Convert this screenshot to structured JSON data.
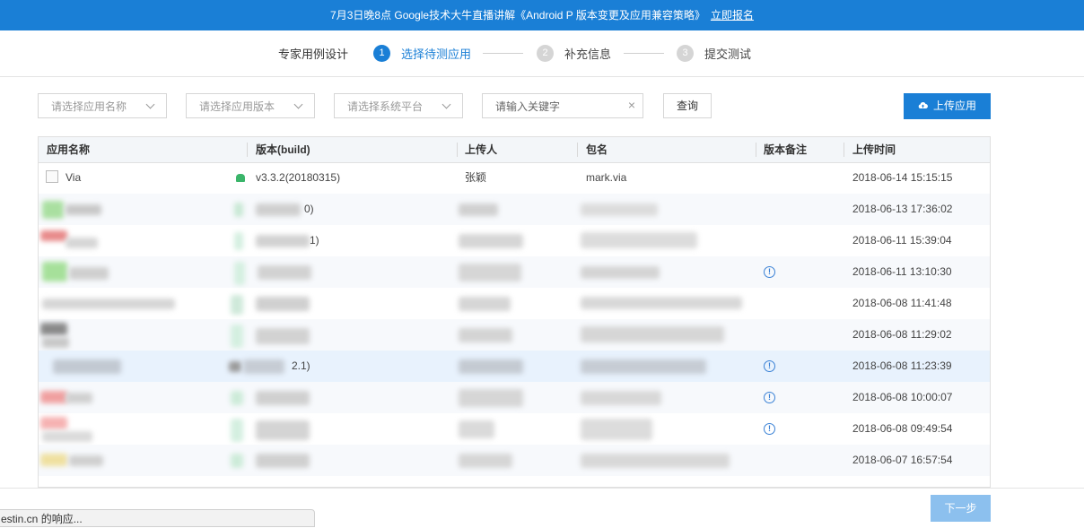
{
  "banner": {
    "text": "7月3日晚8点 Google技术大牛直播讲解《Android P 版本变更及应用兼容策略》",
    "link": "立即报名"
  },
  "steps": {
    "first": "专家用例设计",
    "items": [
      {
        "num": "1",
        "label": "选择待测应用"
      },
      {
        "num": "2",
        "label": "补充信息"
      },
      {
        "num": "3",
        "label": "提交测试"
      }
    ]
  },
  "filters": {
    "app_name": "请选择应用名称",
    "app_version": "请选择应用版本",
    "platform": "请选择系统平台",
    "keyword_placeholder": "请输入关键字",
    "clear_glyph": "×",
    "query": "查询",
    "upload": "上传应用"
  },
  "table": {
    "columns": [
      "应用名称",
      "版本(build)",
      "上传人",
      "包名",
      "版本备注",
      "上传时间"
    ],
    "rows": [
      {
        "name": "Via",
        "version": "v3.3.2(20180315)",
        "uploader": "张颖",
        "package": "mark.via",
        "note": false,
        "time": "2018-06-14 15:15:15"
      },
      {
        "name": "",
        "version": "0)",
        "uploader": "",
        "package": "",
        "note": false,
        "time": "2018-06-13 17:36:02"
      },
      {
        "name": "",
        "version": "1)",
        "uploader": "",
        "package": "",
        "note": false,
        "time": "2018-06-11 15:39:04"
      },
      {
        "name": "",
        "version": "",
        "uploader": "",
        "package": "",
        "note": true,
        "time": "2018-06-11 13:10:30"
      },
      {
        "name": "",
        "version": "",
        "uploader": "",
        "package": "",
        "note": false,
        "time": "2018-06-08 11:41:48"
      },
      {
        "name": "",
        "version": "",
        "uploader": "",
        "package": "",
        "note": false,
        "time": "2018-06-08 11:29:02"
      },
      {
        "name": "",
        "version": "2.1)",
        "uploader": "",
        "package": "",
        "note": true,
        "time": "2018-06-08 11:23:39"
      },
      {
        "name": "",
        "version": "",
        "uploader": "",
        "package": "",
        "note": true,
        "time": "2018-06-08 10:00:07"
      },
      {
        "name": "",
        "version": "",
        "uploader": "",
        "package": "",
        "note": true,
        "time": "2018-06-08 09:49:54"
      },
      {
        "name": "",
        "version": "",
        "uploader": "",
        "package": "",
        "note": false,
        "time": "2018-06-07 16:57:54"
      }
    ]
  },
  "footer": {
    "next": "下一步",
    "status": "estin.cn 的响应..."
  },
  "colors": {
    "brand": "#1a7fd6",
    "next_disabled": "#8cc0ee",
    "highlight_row": "#e8f2fd"
  },
  "icons": {
    "upload": "upload-cloud-icon",
    "note": "info-circle-icon",
    "android": "android-icon"
  }
}
